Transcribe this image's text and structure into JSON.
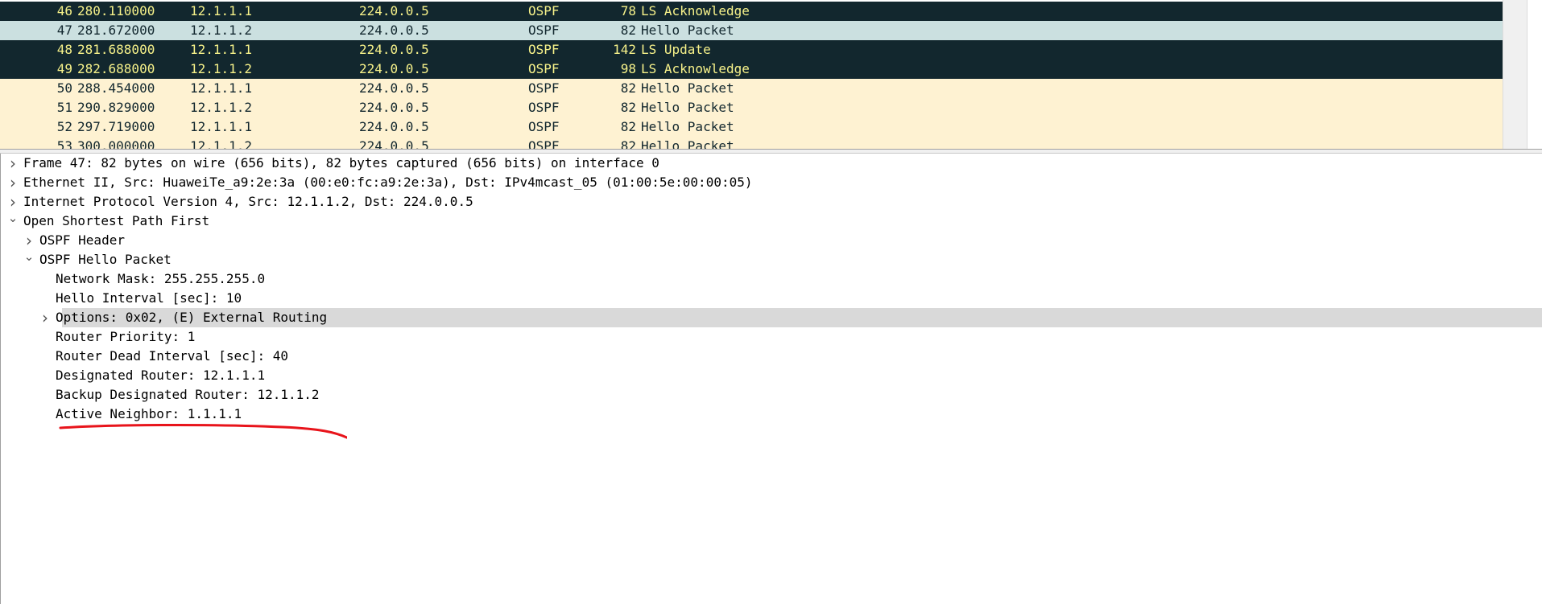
{
  "packet_list": {
    "rows": [
      {
        "no": "46",
        "time": "280.110000",
        "src": "12.1.1.1",
        "dst": "224.0.0.5",
        "proto": "OSPF",
        "len": "78",
        "info": "LS Acknowledge",
        "bg": "#12272e",
        "fg": "#f7f28a"
      },
      {
        "no": "47",
        "time": "281.672000",
        "src": "12.1.1.2",
        "dst": "224.0.0.5",
        "proto": "OSPF",
        "len": "82",
        "info": "Hello Packet",
        "bg": "#cbe0e0",
        "fg": "#12272e"
      },
      {
        "no": "48",
        "time": "281.688000",
        "src": "12.1.1.1",
        "dst": "224.0.0.5",
        "proto": "OSPF",
        "len": "142",
        "info": "LS Update",
        "bg": "#12272e",
        "fg": "#f7f28a"
      },
      {
        "no": "49",
        "time": "282.688000",
        "src": "12.1.1.2",
        "dst": "224.0.0.5",
        "proto": "OSPF",
        "len": "98",
        "info": "LS Acknowledge",
        "bg": "#12272e",
        "fg": "#f7f28a"
      },
      {
        "no": "50",
        "time": "288.454000",
        "src": "12.1.1.1",
        "dst": "224.0.0.5",
        "proto": "OSPF",
        "len": "82",
        "info": "Hello Packet",
        "bg": "#fef2d2",
        "fg": "#12272e"
      },
      {
        "no": "51",
        "time": "290.829000",
        "src": "12.1.1.2",
        "dst": "224.0.0.5",
        "proto": "OSPF",
        "len": "82",
        "info": "Hello Packet",
        "bg": "#fef2d2",
        "fg": "#12272e"
      },
      {
        "no": "52",
        "time": "297.719000",
        "src": "12.1.1.1",
        "dst": "224.0.0.5",
        "proto": "OSPF",
        "len": "82",
        "info": "Hello Packet",
        "bg": "#fef2d2",
        "fg": "#12272e"
      },
      {
        "no": "53",
        "time": "300.000000",
        "src": "12.1.1.2",
        "dst": "224.0.0.5",
        "proto": "OSPF",
        "len": "82",
        "info": "Hello Packet",
        "bg": "#fef2d2",
        "fg": "#12272e"
      }
    ]
  },
  "details": {
    "items": [
      {
        "text": "Frame 47: 82 bytes on wire (656 bits), 82 bytes captured (656 bits) on interface 0",
        "depth": 0,
        "arrow": "collapsed",
        "selected": false
      },
      {
        "text": "Ethernet II, Src: HuaweiTe_a9:2e:3a (00:e0:fc:a9:2e:3a), Dst: IPv4mcast_05 (01:00:5e:00:00:05)",
        "depth": 0,
        "arrow": "collapsed",
        "selected": false
      },
      {
        "text": "Internet Protocol Version 4, Src: 12.1.1.2, Dst: 224.0.0.5",
        "depth": 0,
        "arrow": "collapsed",
        "selected": false
      },
      {
        "text": "Open Shortest Path First",
        "depth": 0,
        "arrow": "expanded",
        "selected": false
      },
      {
        "text": "OSPF Header",
        "depth": 1,
        "arrow": "collapsed",
        "selected": false
      },
      {
        "text": "OSPF Hello Packet",
        "depth": 1,
        "arrow": "expanded",
        "selected": false
      },
      {
        "text": "Network Mask: 255.255.255.0",
        "depth": 2,
        "arrow": "none",
        "selected": false
      },
      {
        "text": "Hello Interval [sec]: 10",
        "depth": 2,
        "arrow": "none",
        "selected": false
      },
      {
        "text": "Options: 0x02, (E) External Routing",
        "depth": 2,
        "arrow": "collapsed",
        "selected": true
      },
      {
        "text": "Router Priority: 1",
        "depth": 2,
        "arrow": "none",
        "selected": false
      },
      {
        "text": "Router Dead Interval [sec]: 40",
        "depth": 2,
        "arrow": "none",
        "selected": false
      },
      {
        "text": "Designated Router: 12.1.1.1",
        "depth": 2,
        "arrow": "none",
        "selected": false
      },
      {
        "text": "Backup Designated Router: 12.1.1.2",
        "depth": 2,
        "arrow": "none",
        "selected": false
      },
      {
        "text": "Active Neighbor: 1.1.1.1",
        "depth": 2,
        "arrow": "none",
        "selected": false
      }
    ]
  },
  "icons": {
    "collapsed": "chevron-right-icon",
    "expanded": "chevron-down-icon"
  },
  "annotation_color": "#e8141b",
  "selection_color": "#d9d9d9"
}
